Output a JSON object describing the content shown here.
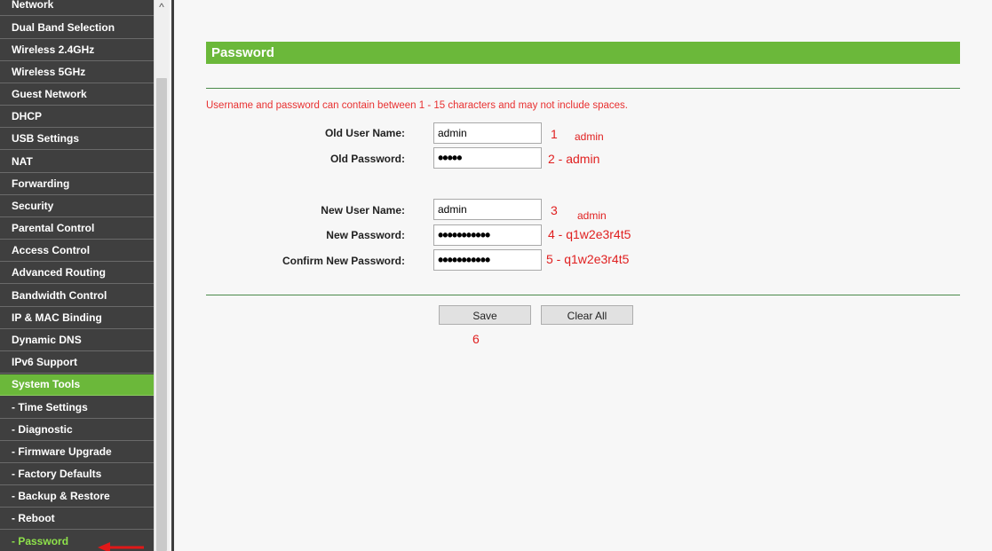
{
  "sidebar": {
    "items": [
      {
        "label": "Network"
      },
      {
        "label": "Dual Band Selection"
      },
      {
        "label": "Wireless 2.4GHz"
      },
      {
        "label": "Wireless 5GHz"
      },
      {
        "label": "Guest Network"
      },
      {
        "label": "DHCP"
      },
      {
        "label": "USB Settings"
      },
      {
        "label": "NAT"
      },
      {
        "label": "Forwarding"
      },
      {
        "label": "Security"
      },
      {
        "label": "Parental Control"
      },
      {
        "label": "Access Control"
      },
      {
        "label": "Advanced Routing"
      },
      {
        "label": "Bandwidth Control"
      },
      {
        "label": "IP & MAC Binding"
      },
      {
        "label": "Dynamic DNS"
      },
      {
        "label": "IPv6 Support"
      },
      {
        "label": "System Tools"
      },
      {
        "label": "- Time Settings"
      },
      {
        "label": "- Diagnostic"
      },
      {
        "label": "- Firmware Upgrade"
      },
      {
        "label": "- Factory Defaults"
      },
      {
        "label": "- Backup & Restore"
      },
      {
        "label": "- Reboot"
      },
      {
        "label": "- Password"
      }
    ]
  },
  "colors": {
    "accent": "#6bb83a",
    "sidebar_bg": "#3f3f3f",
    "notice": "#e83030",
    "annotation": "#e02020"
  },
  "main": {
    "section_title": "Password",
    "notice": "Username and password can contain between 1 - 15 characters and may not include spaces.",
    "fields": {
      "old_user_name": {
        "label": "Old User Name:",
        "value": "admin"
      },
      "old_password": {
        "label": "Old Password:",
        "value": "•••••"
      },
      "new_user_name": {
        "label": "New User Name:",
        "value": "admin"
      },
      "new_password": {
        "label": "New Password:",
        "value": "•••••••••••"
      },
      "confirm_new_password": {
        "label": "Confirm New Password:",
        "value": "•••••••••••"
      }
    },
    "buttons": {
      "save": "Save",
      "clear_all": "Clear All"
    }
  },
  "annotations": {
    "a1_num": "1",
    "a1_text": "admin",
    "a2": "2 - admin",
    "a3_num": "3",
    "a3_text": "admin",
    "a4": "4 - q1w2e3r4t5",
    "a5": "5 - q1w2e3r4t5",
    "a6": "6"
  }
}
